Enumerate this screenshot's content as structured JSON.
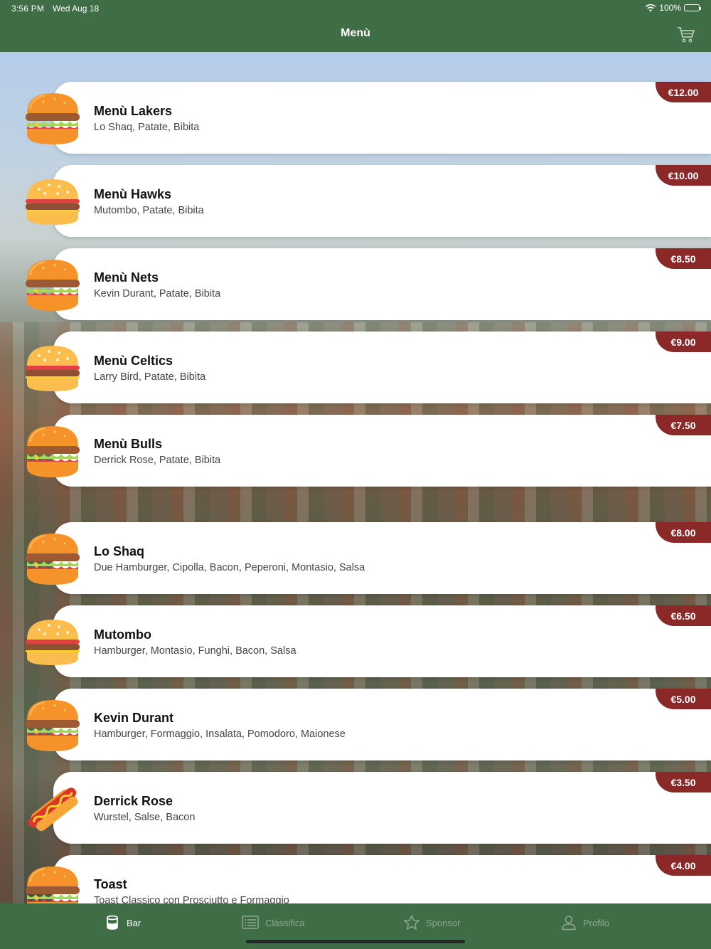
{
  "status_bar": {
    "time": "3:56 PM",
    "date": "Wed Aug 18",
    "battery": "100%"
  },
  "header": {
    "title": "Menù",
    "cart_icon": "cart-icon"
  },
  "colors": {
    "primary_green": "#3f6d45",
    "price_red": "#8b2828"
  },
  "menu": {
    "items": [
      {
        "name": "Menù Lakers",
        "description": "Lo Shaq, Patate, Bibita",
        "price": "€12.00",
        "icon": "burger-icon"
      },
      {
        "name": "Menù Hawks",
        "description": "Mutombo, Patate, Bibita",
        "price": "€10.00",
        "icon": "cheeseburger-icon"
      },
      {
        "name": "Menù Nets",
        "description": "Kevin Durant, Patate, Bibita",
        "price": "€8.50",
        "icon": "burger-icon"
      },
      {
        "name": "Menù Celtics",
        "description": "Larry Bird, Patate, Bibita",
        "price": "€9.00",
        "icon": "cheeseburger-icon"
      },
      {
        "name": "Menù Bulls",
        "description": "Derrick Rose, Patate, Bibita",
        "price": "€7.50",
        "icon": "burger-icon"
      },
      {
        "name": "Lo Shaq",
        "description": "Due Hamburger, Cipolla, Bacon, Peperoni, Montasio, Salsa",
        "price": "€8.00",
        "icon": "burger-icon"
      },
      {
        "name": "Mutombo",
        "description": "Hamburger, Montasio, Funghi, Bacon, Salsa",
        "price": "€6.50",
        "icon": "cheeseburger-icon"
      },
      {
        "name": "Kevin Durant",
        "description": "Hamburger, Formaggio, Insalata, Pomodoro, Maionese",
        "price": "€5.00",
        "icon": "burger-icon"
      },
      {
        "name": "Derrick Rose",
        "description": "Wurstel, Salse, Bacon",
        "price": "€3.50",
        "icon": "hotdog-icon"
      },
      {
        "name": "Toast",
        "description": "Toast Classico con Prosciutto e Formaggio",
        "price": "€4.00",
        "icon": "burger-icon"
      }
    ]
  },
  "tabbar": {
    "tabs": [
      {
        "label": "Bar",
        "icon": "cup-icon",
        "active": true
      },
      {
        "label": "Classifica",
        "icon": "list-icon",
        "active": false
      },
      {
        "label": "Sponsor",
        "icon": "star-icon",
        "active": false
      },
      {
        "label": "Profilo",
        "icon": "person-icon",
        "active": false
      }
    ]
  }
}
